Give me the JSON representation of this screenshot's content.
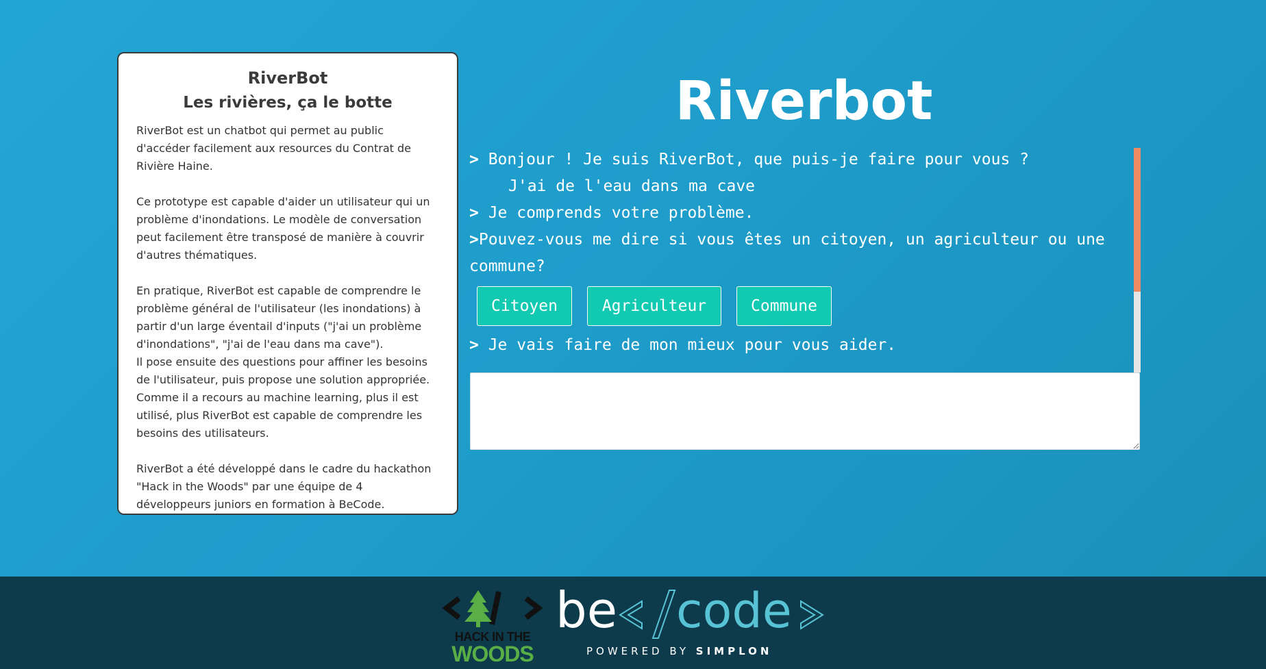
{
  "info": {
    "title": "RiverBot",
    "subtitle": "Les rivières, ça le botte",
    "para1": "RiverBot est un chatbot qui permet au public d'accéder facilement aux resources du Contrat de Rivière Haine.",
    "para2": "Ce prototype est capable d'aider un utilisateur qui un problème d'inondations. Le modèle de conversation peut facilement être transposé de manière à couvrir d'autres thématiques.",
    "para3a": "En pratique, RiverBot est capable de comprendre le problème général de l'utilisateur (les inondations) à partir d'un large éventail d'inputs (\"j'ai un problème d'inondations\", \"j'ai de l'eau dans ma cave\").",
    "para3b": "Il pose ensuite des questions pour affiner les besoins de l'utilisateur, puis propose une solution appropriée. Comme il a recours au machine learning, plus il est utilisé, plus RiverBot est capable de comprendre les besoins des utilisateurs.",
    "para4": "RiverBot a été développé dans le cadre du hackathon \"Hack in the Woods\" par une équipe de 4 développeurs juniors en formation à BeCode."
  },
  "app": {
    "title": "Riverbot"
  },
  "chat": {
    "prompt_glyph": ">",
    "msg1": " Bonjour ! Je suis RiverBot, que puis-je faire pour vous ?",
    "user1": "J'ai de l'eau dans ma cave",
    "msg2": " Je comprends votre problème.",
    "msg3": "Pouvez-vous me dire si vous êtes un citoyen, un agriculteur ou une commune?",
    "choices": [
      "Citoyen",
      "Agriculteur",
      "Commune"
    ],
    "msg4": " Je vais faire de mon mieux pour vous aider.",
    "input_value": ""
  },
  "scroll": {
    "visible_fraction": 0.64
  },
  "footer": {
    "hack_line1": "HACK IN THE",
    "hack_line2": "WOODS",
    "becode_be": "be",
    "becode_code": "code",
    "powered_by": "POWERED BY",
    "powered_brand": "SIMPLON"
  },
  "colors": {
    "background": "#1f9fcf",
    "button": "#12c9b1",
    "scroll_thumb": "#ee8a63",
    "footer": "#0d3b4c",
    "becode_accent": "#58c3d4",
    "woods_green": "#5aae46"
  }
}
